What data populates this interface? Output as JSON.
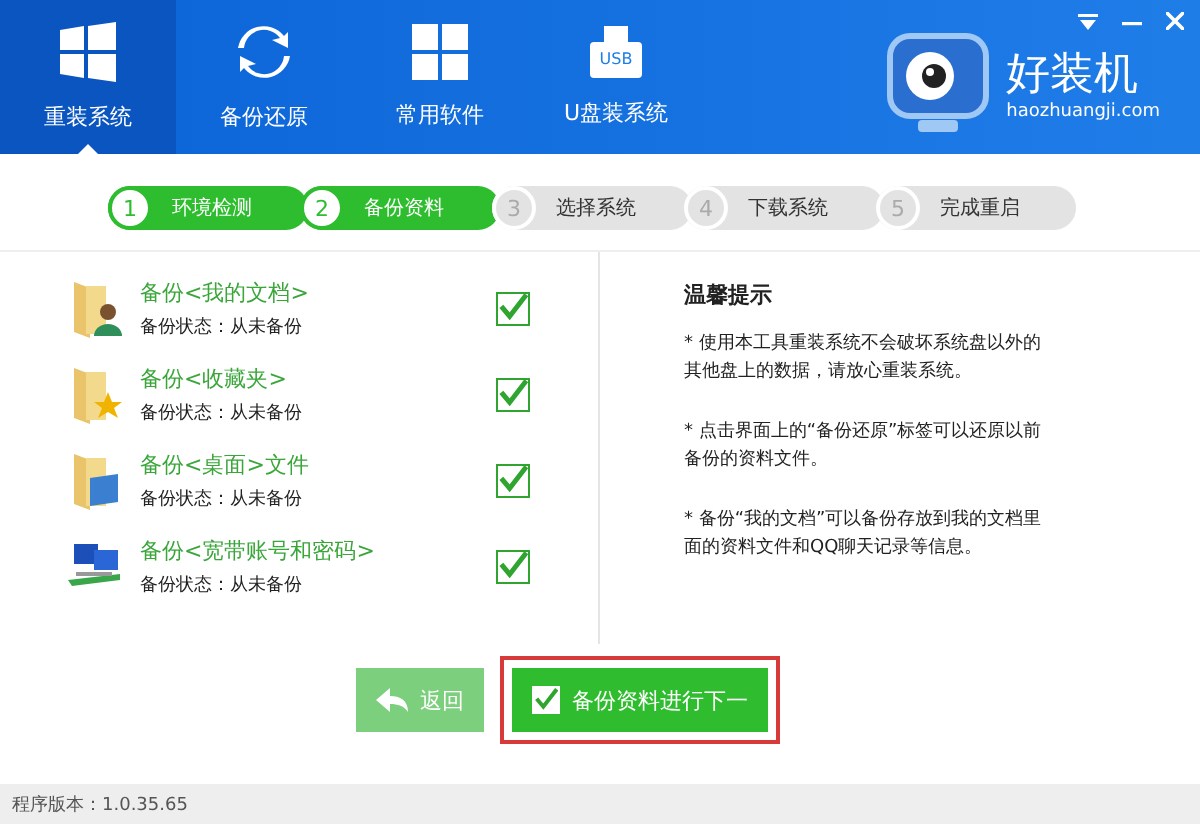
{
  "nav": [
    {
      "label": "重装系统",
      "kind": "windows",
      "selected": true
    },
    {
      "label": "备份还原",
      "kind": "sync",
      "selected": false
    },
    {
      "label": "常用软件",
      "kind": "grid",
      "selected": false
    },
    {
      "label": "U盘装系统",
      "kind": "usb",
      "selected": false
    }
  ],
  "usb_label": "USB",
  "brand": {
    "name": "好装机",
    "url": "haozhuangji.com"
  },
  "steps": [
    {
      "number": "1",
      "label": "环境检测",
      "done": true
    },
    {
      "number": "2",
      "label": "备份资料",
      "done": true
    },
    {
      "number": "3",
      "label": "选择系统",
      "done": false
    },
    {
      "number": "4",
      "label": "下载系统",
      "done": false
    },
    {
      "number": "5",
      "label": "完成重启",
      "done": false
    }
  ],
  "items": [
    {
      "title": "备份<我的文档>",
      "status": "备份状态：从未备份",
      "kind": "user",
      "checked": true
    },
    {
      "title": "备份<收藏夹>",
      "status": "备份状态：从未备份",
      "kind": "star",
      "checked": true
    },
    {
      "title": "备份<桌面>文件",
      "status": "备份状态：从未备份",
      "kind": "desktop",
      "checked": true
    },
    {
      "title": "备份<宽带账号和密码>",
      "status": "备份状态：从未备份",
      "kind": "network",
      "checked": true
    }
  ],
  "tips": {
    "title": "温馨提示",
    "lines": [
      "* 使用本工具重装系统不会破坏系统盘以外的其他盘上的数据，请放心重装系统。",
      "* 点击界面上的“备份还原”标签可以还原以前备份的资料文件。",
      "* 备份“我的文档”可以备份存放到我的文档里面的资料文件和QQ聊天记录等信息。"
    ]
  },
  "back_button": "返回",
  "next_button": {
    "label": "备份资料进行下一",
    "checked": true,
    "highlighted": true
  },
  "version": "程序版本：1.0.35.65"
}
